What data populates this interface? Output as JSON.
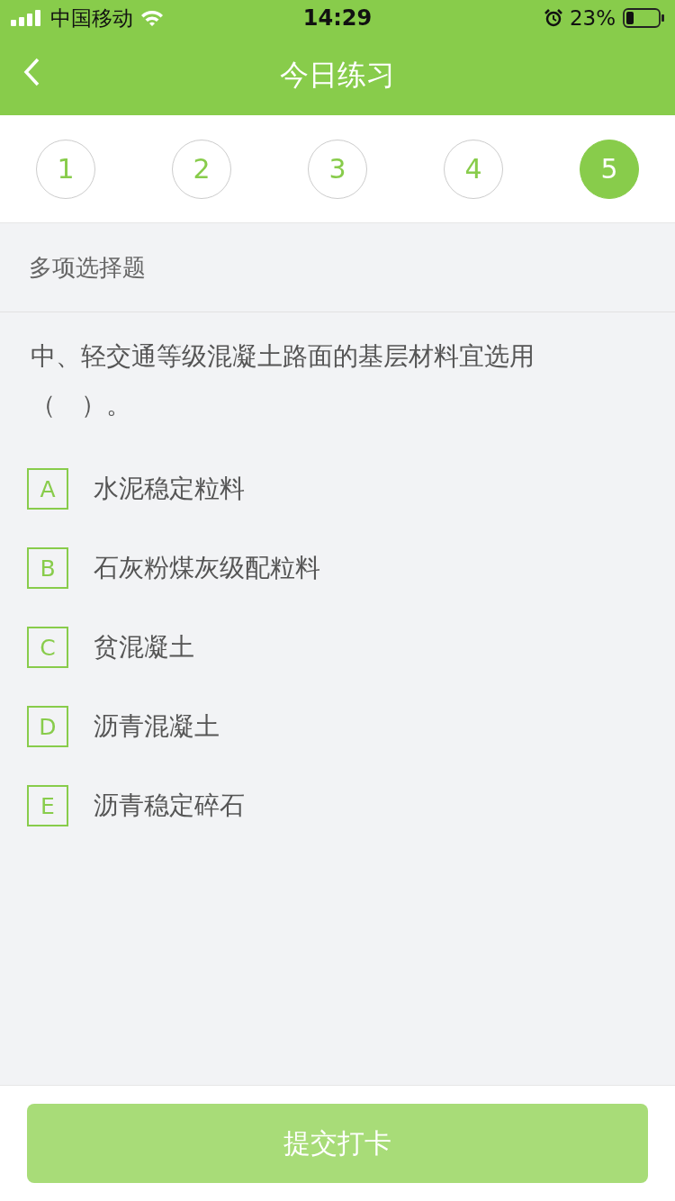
{
  "status_bar": {
    "carrier": "中国移动",
    "time": "14:29",
    "battery": "23%"
  },
  "nav": {
    "title": "今日练习"
  },
  "questions": [
    {
      "label": "1",
      "selected": false
    },
    {
      "label": "2",
      "selected": false
    },
    {
      "label": "3",
      "selected": false
    },
    {
      "label": "4",
      "selected": false
    },
    {
      "label": "5",
      "selected": true
    }
  ],
  "section": {
    "title": "多项选择题"
  },
  "question": {
    "text": "中、轻交通等级混凝土路面的基层材料宜选用（　）。"
  },
  "options": [
    {
      "letter": "A",
      "text": "水泥稳定粒料",
      "checked": false
    },
    {
      "letter": "B",
      "text": "石灰粉煤灰级配粒料",
      "checked": false
    },
    {
      "letter": "C",
      "text": "贫混凝土",
      "checked": false
    },
    {
      "letter": "D",
      "text": "沥青混凝土",
      "checked": false
    },
    {
      "letter": "E",
      "text": "沥青稳定碎石",
      "checked": false
    }
  ],
  "submit": {
    "label": "提交打卡",
    "disabled": true
  }
}
